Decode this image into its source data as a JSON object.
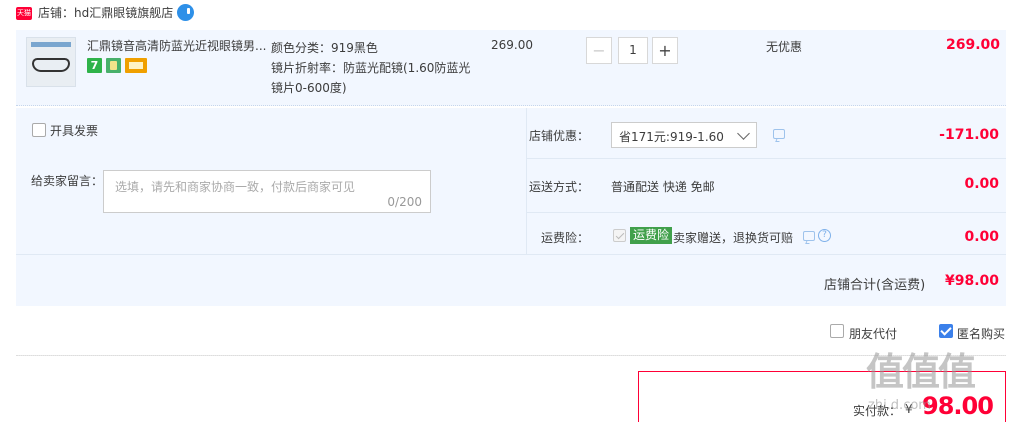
{
  "shop": {
    "badge": "天猫",
    "label": "店铺：hd汇鼎眼镜旗舰店"
  },
  "item": {
    "title": "汇鼎镜音高清防蓝光近视眼镜男...",
    "sku_color": "颜色分类：919黑色",
    "sku_lens": "镜片折射率：防蓝光配镜(1.60防蓝光镜片0-600度)",
    "unit_price": "269.00",
    "qty_minus": "−",
    "quantity": "1",
    "qty_plus": "+",
    "discount": "无优惠",
    "subtotal": "269.00",
    "service_icon_7": "7"
  },
  "options": {
    "invoice_label": "开具发票",
    "message_label": "给卖家留言：",
    "message_placeholder": "选填，请先和商家协商一致，付款后商家可见",
    "message_count": "0/200",
    "shop_discount_label": "店铺优惠：",
    "shop_discount_value": "省171元:919-1.60",
    "shop_discount_amount": "-171.00",
    "shipping_label": "运送方式：",
    "shipping_value": "普通配送 快递 免邮",
    "shipping_amount": "0.00",
    "insurance_label": "运费险：",
    "insurance_tag": "运费险",
    "insurance_desc": "卖家赠送，退换货可赔",
    "insurance_amount": "0.00",
    "help_glyph": "?",
    "total_label": "店铺合计(含运费)",
    "total_amount": "¥98.00"
  },
  "bottom": {
    "friend_pay_label": "朋友代付",
    "anonymous_label": "匿名购买",
    "anonymous_checked": true,
    "pay_label": "实付款：",
    "pay_currency": "¥",
    "pay_amount": "98.00"
  },
  "watermark": {
    "text": "值值值",
    "sub": "zhi.d.com"
  },
  "colors": {
    "accent_red": "#ff0036",
    "panel_bg": "#f2f7ff",
    "checkbox_blue": "#3b80ea",
    "insurance_green": "#41a04b"
  },
  "icons": [
    "tmall-badge-icon",
    "wangwang-chat-icon",
    "service-7day-icon",
    "service-guarantee-icon",
    "service-card-icon",
    "chat-bubble-icon",
    "help-icon",
    "chevron-down-icon",
    "check-icon"
  ]
}
